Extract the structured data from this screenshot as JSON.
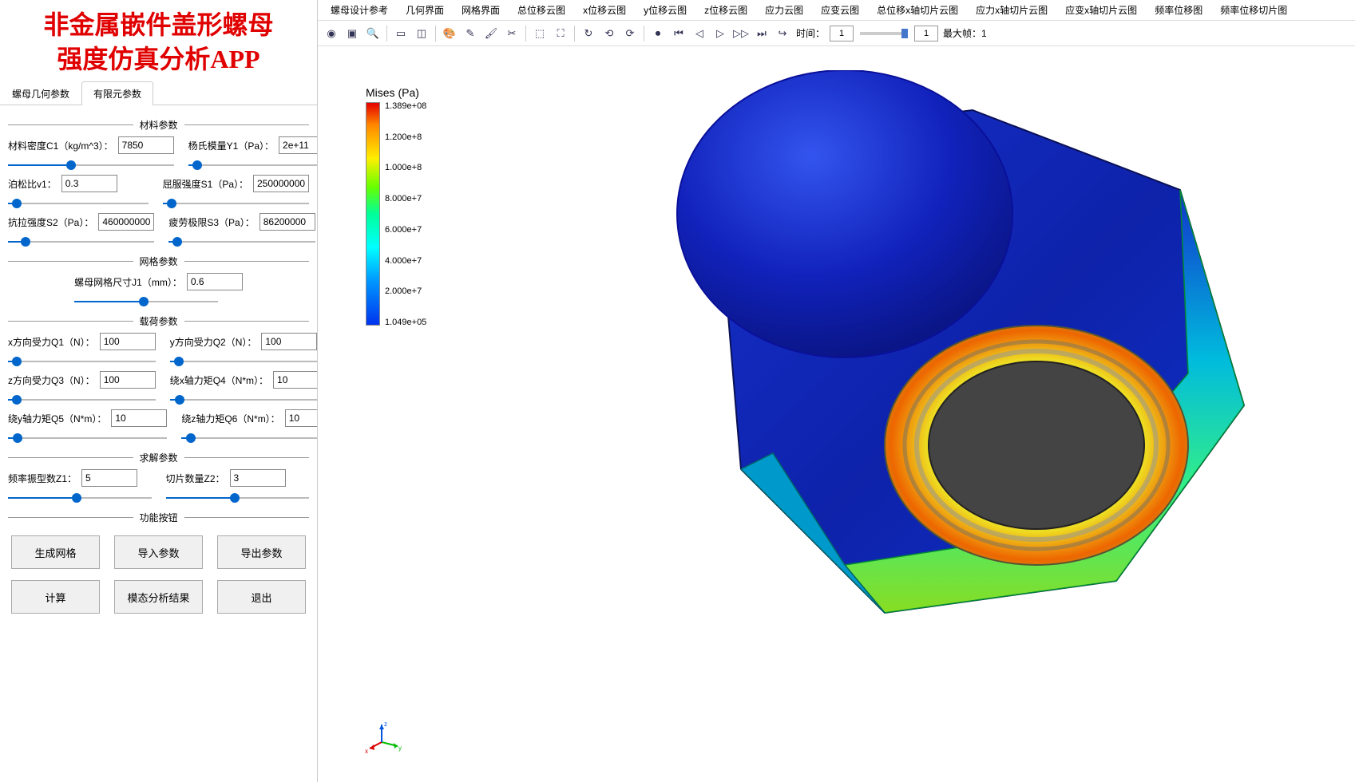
{
  "title": {
    "line1": "非金属嵌件盖形螺母",
    "line2": "强度仿真分析APP"
  },
  "sidebar": {
    "tabs": [
      "螺母几何参数",
      "有限元参数"
    ],
    "active_tab": 1,
    "groups": {
      "material": {
        "title": "材料参数",
        "c1_label": "材料密度C1（kg/m^3）：",
        "c1_value": "7850",
        "c1_pct": 38,
        "y1_label": "杨氏模量Y1（Pa）：",
        "y1_value": "2e+11",
        "y1_pct": 6,
        "v1_label": "泊松比v1：",
        "v1_value": "0.3",
        "v1_pct": 6,
        "s1_label": "屈服强度S1（Pa）：",
        "s1_value": "250000000",
        "s1_pct": 6,
        "s2_label": "抗拉强度S2（Pa）：",
        "s2_value": "460000000",
        "s2_pct": 12,
        "s3_label": "疲劳极限S3（Pa）：",
        "s3_value": "86200000",
        "s3_pct": 6
      },
      "mesh": {
        "title": "网格参数",
        "j1_label": "螺母网格尺寸J1（mm）：",
        "j1_value": "0.6",
        "j1_pct": 48
      },
      "load": {
        "title": "载荷参数",
        "q1_label": "x方向受力Q1（N）：",
        "q1_value": "100",
        "q1_pct": 6,
        "q2_label": "y方向受力Q2（N）：",
        "q2_value": "100",
        "q2_pct": 6,
        "q3_label": "z方向受力Q3（N）：",
        "q3_value": "100",
        "q3_pct": 6,
        "q4_label": "绕x轴力矩Q4（N*m）：",
        "q4_value": "10",
        "q4_pct": 6,
        "q5_label": "绕y轴力矩Q5（N*m）：",
        "q5_value": "10",
        "q5_pct": 6,
        "q6_label": "绕z轴力矩Q6（N*m）：",
        "q6_value": "10",
        "q6_pct": 6
      },
      "solve": {
        "title": "求解参数",
        "z1_label": "频率振型数Z1：",
        "z1_value": "5",
        "z1_pct": 48,
        "z2_label": "切片数量Z2：",
        "z2_value": "3",
        "z2_pct": 48
      },
      "buttons": {
        "title": "功能按钮",
        "gen_mesh": "生成网格",
        "import_params": "导入参数",
        "export_params": "导出参数",
        "compute": "计算",
        "modal_results": "模态分析结果",
        "exit": "退出"
      }
    }
  },
  "menubar": [
    "螺母设计参考",
    "几何界面",
    "网格界面",
    "总位移云图",
    "x位移云图",
    "y位移云图",
    "z位移云图",
    "应力云图",
    "应变云图",
    "总位移x轴切片云图",
    "应力x轴切片云图",
    "应变x轴切片云图",
    "频率位移图",
    "频率位移切片图"
  ],
  "toolbar": {
    "time_label": "时间：",
    "time_value": "1",
    "frame_value": "1",
    "max_frame_label": "最大帧：",
    "max_frame_value": "1"
  },
  "legend": {
    "title": "Mises (Pa)",
    "ticks": [
      "1.389e+08",
      "1.200e+8",
      "1.000e+8",
      "8.000e+7",
      "6.000e+7",
      "4.000e+7",
      "2.000e+7",
      "1.049e+05"
    ]
  },
  "chart_data": {
    "type": "heatmap",
    "title": "Mises (Pa)",
    "colorscale": "rainbow",
    "range": [
      104900.0,
      138900000.0
    ],
    "ticks": [
      138900000.0,
      120000000.0,
      100000000.0,
      80000000.0,
      60000000.0,
      40000000.0,
      20000000.0,
      104900.0
    ]
  }
}
